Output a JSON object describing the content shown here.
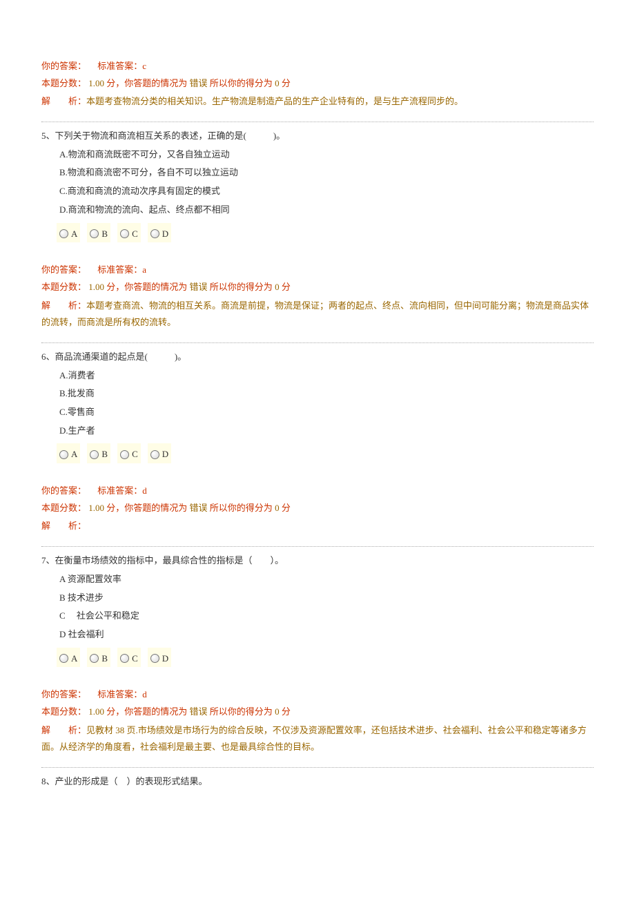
{
  "labels": {
    "your_answer": "你的答案：",
    "std_answer_prefix": "标准答案：",
    "score_prefix": "本题分数：",
    "score_mid1": " 分，你答题的情况为 ",
    "score_mid2": " 所以你的得分为 ",
    "score_suffix": " 分",
    "analysis_label": "解　　析：",
    "radio_A": "A",
    "radio_B": "B",
    "radio_C": "C",
    "radio_D": "D"
  },
  "q4": {
    "std_answer": "c",
    "full_score": "1.00",
    "status": "错误",
    "got_score": "0",
    "analysis": "本题考查物流分类的相关知识。生产物流是制造产品的生产企业特有的，是与生产流程同步的。"
  },
  "q5": {
    "num": "5、",
    "stem": "下列关于物流和商流相互关系的表述，正确的是(　　　)。",
    "A": "A.物流和商流既密不可分，又各自独立运动",
    "B": "B.物流和商流密不可分，各自不可以独立运动",
    "C": "C.商流和商流的流动次序具有固定的模式",
    "D": "D.商流和物流的流向、起点、终点都不相同",
    "std_answer": "a",
    "full_score": "1.00",
    "status": "错误",
    "got_score": "0",
    "analysis": "本题考查商流、物流的相互关系。商流是前提，物流是保证；两者的起点、终点、流向相同，但中间可能分离；物流是商品实体的流转，而商流是所有权的流转。"
  },
  "q6": {
    "num": "6、",
    "stem": "商品流通渠道的起点是(　　　)。",
    "A": "A.消费者",
    "B": "B.批发商",
    "C": "C.零售商",
    "D": "D.生产者",
    "std_answer": "d",
    "full_score": "1.00",
    "status": "错误",
    "got_score": "0",
    "analysis": ""
  },
  "q7": {
    "num": "7、",
    "stem": "在衡量市场绩效的指标中，最具综合性的指标是（　　）。",
    "A": "A 资源配置效率",
    "B": "B 技术进步",
    "C": "C　 社会公平和稳定",
    "D": "D 社会福利",
    "std_answer": "d",
    "full_score": "1.00",
    "status": "错误",
    "got_score": "0",
    "analysis": "见教材 38 页.市场绩效是市场行为的综合反映，不仅涉及资源配置效率，还包括技术进步、社会福利、社会公平和稳定等诸多方面。从经济学的角度看，社会福利是最主要、也是最具综合性的目标。"
  },
  "q8": {
    "num": "8、",
    "stem": "产业的形成是（　）的表现形式结果。"
  }
}
